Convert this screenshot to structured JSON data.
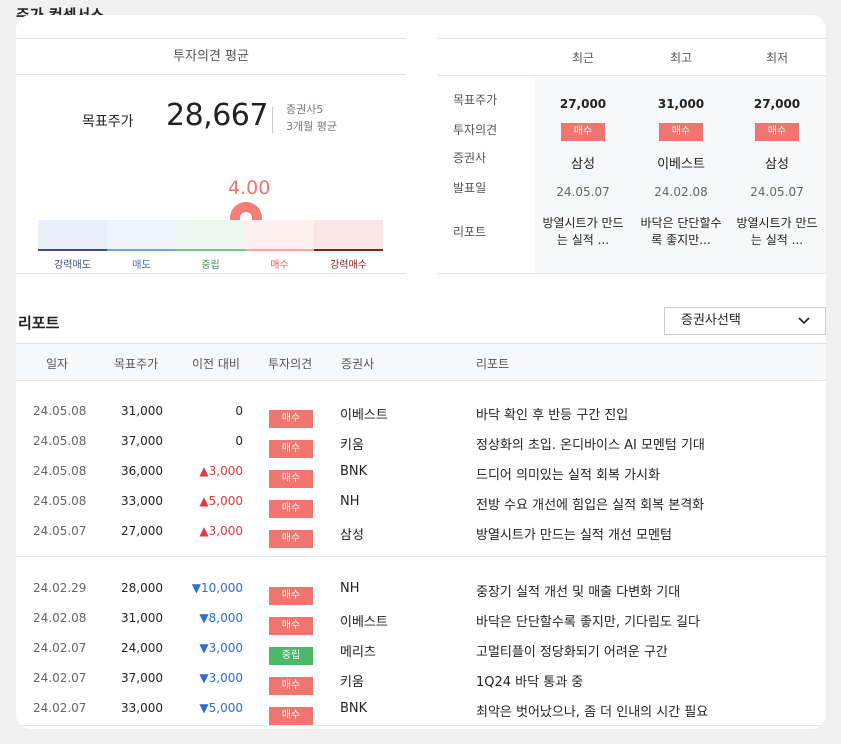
{
  "page_title": "주가 컨센서스",
  "consensus": {
    "header": "투자의견 평균",
    "target_label": "목표주가",
    "target_value": "28,667",
    "brokers": "증권사5",
    "period": "3개월 평균",
    "score": "4.00",
    "score_value": 4.0,
    "scale": [
      {
        "label": "강력매도",
        "bg": "#e9eff8",
        "line": "#3c4d79",
        "text": "#3c4d79"
      },
      {
        "label": "매도",
        "bg": "#edf4fd",
        "line": "#6fa3e6",
        "text": "#3e6fbf"
      },
      {
        "label": "중립",
        "bg": "#edf6ef",
        "line": "#7cc38c",
        "text": "#3f8f4f"
      },
      {
        "label": "매수",
        "bg": "#fdf0ef",
        "line": "#f3a6a1",
        "text": "#e0625c"
      },
      {
        "label": "강력매수",
        "bg": "#fbe6e6",
        "line": "#8a1d1d",
        "text": "#8a1d1d"
      }
    ]
  },
  "recent": {
    "columns": [
      "최근",
      "최고",
      "최저"
    ],
    "row_labels": [
      "목표주가",
      "투자의견",
      "증권사",
      "발표일",
      "리포트"
    ],
    "cols": [
      {
        "target": "27,000",
        "opinion": "매수",
        "broker": "삼성",
        "date": "24.05.07",
        "report": "방열시트가 만드는 실적 ..."
      },
      {
        "target": "31,000",
        "opinion": "매수",
        "broker": "이베스트",
        "date": "24.02.08",
        "report": "바닥은 단단할수록 좋지만..."
      },
      {
        "target": "27,000",
        "opinion": "매수",
        "broker": "삼성",
        "date": "24.05.07",
        "report": "방열시트가 만드는 실적 ..."
      }
    ]
  },
  "reports": {
    "title": "리포트",
    "select_label": "증권사선택",
    "headers": {
      "date": "일자",
      "target": "목표주가",
      "change": "이전 대비",
      "opinion": "투자의견",
      "broker": "증권사",
      "report": "리포트"
    },
    "rows": [
      {
        "date": "24.05.08",
        "target": "31,000",
        "change": "0",
        "dir": "zero",
        "opinion": "매수",
        "op_type": "buy",
        "broker": "이베스트",
        "report": "바닥 확인 후 반등 구간 진입"
      },
      {
        "date": "24.05.08",
        "target": "37,000",
        "change": "0",
        "dir": "zero",
        "opinion": "매수",
        "op_type": "buy",
        "broker": "키움",
        "report": "정상화의 초입. 온디바이스 AI 모멘텀 기대"
      },
      {
        "date": "24.05.08",
        "target": "36,000",
        "change": "▲3,000",
        "dir": "up",
        "opinion": "매수",
        "op_type": "buy",
        "broker": "BNK",
        "report": "드디어 의미있는 실적 회복 가시화"
      },
      {
        "date": "24.05.08",
        "target": "33,000",
        "change": "▲5,000",
        "dir": "up",
        "opinion": "매수",
        "op_type": "buy",
        "broker": "NH",
        "report": "전방 수요 개선에 힘입은 실적 회복 본격화"
      },
      {
        "date": "24.05.07",
        "target": "27,000",
        "change": "▲3,000",
        "dir": "up",
        "opinion": "매수",
        "op_type": "buy",
        "broker": "삼성",
        "report": "방열시트가 만드는 실적 개선 모멘텀"
      },
      {
        "date": "24.02.29",
        "target": "28,000",
        "change": "▼10,000",
        "dir": "down",
        "opinion": "매수",
        "op_type": "buy",
        "broker": "NH",
        "report": "중장기 실적 개선 및 매출 다변화 기대"
      },
      {
        "date": "24.02.08",
        "target": "31,000",
        "change": "▼8,000",
        "dir": "down",
        "opinion": "매수",
        "op_type": "buy",
        "broker": "이베스트",
        "report": "바닥은 단단할수록 좋지만, 기다림도 길다"
      },
      {
        "date": "24.02.07",
        "target": "24,000",
        "change": "▼3,000",
        "dir": "down",
        "opinion": "중립",
        "op_type": "neutral",
        "broker": "메리츠",
        "report": "고멀티플이 정당화되기 어려운 구간"
      },
      {
        "date": "24.02.07",
        "target": "37,000",
        "change": "▼3,000",
        "dir": "down",
        "opinion": "매수",
        "op_type": "buy",
        "broker": "키움",
        "report": "1Q24 바닥 통과 중"
      },
      {
        "date": "24.02.07",
        "target": "33,000",
        "change": "▼5,000",
        "dir": "down",
        "opinion": "매수",
        "op_type": "buy",
        "broker": "BNK",
        "report": "최악은 벗어났으나, 좀 더 인내의 시간 필요"
      }
    ]
  }
}
